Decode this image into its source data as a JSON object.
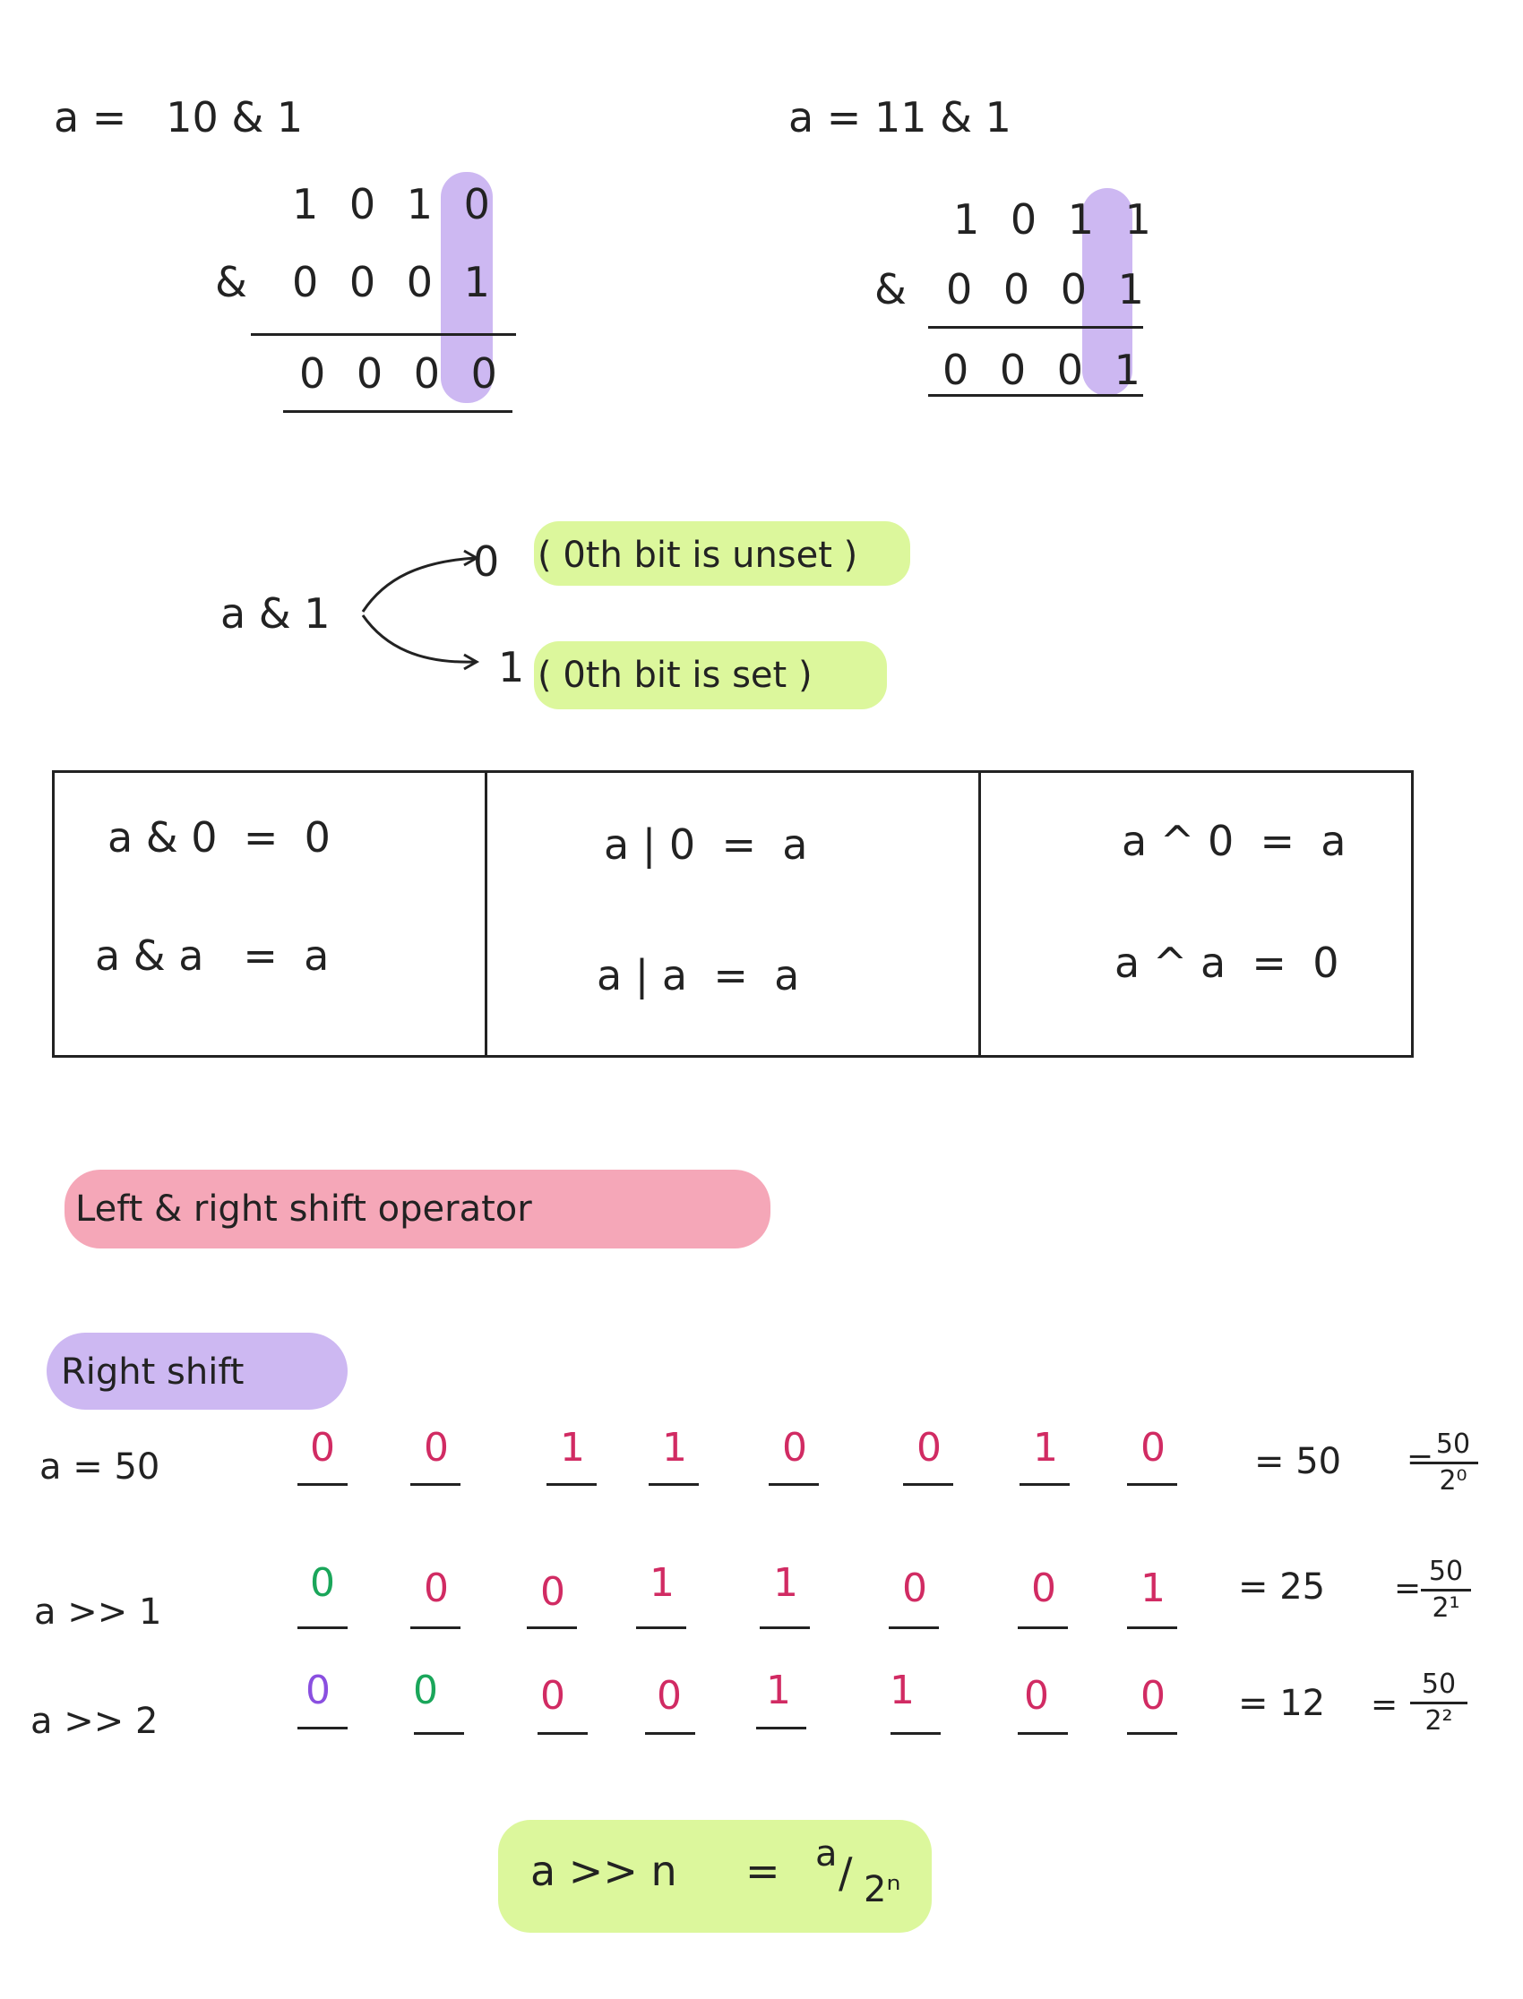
{
  "example1": {
    "title": "a =   10 & 1",
    "row1": "1 0 1 0",
    "op": "&",
    "row2": "0 0 0 1",
    "result": "0 0 0 0"
  },
  "example2": {
    "title": "a = 11 & 1",
    "row1": "1 0 1 1",
    "op": "&",
    "row2": "0 0 0 1",
    "result": "0 0 0 1"
  },
  "branch": {
    "expr": "a & 1",
    "zero_val": "0",
    "zero_note": "( 0th bit is unset )",
    "one_val": "1",
    "one_note": "( 0th bit is set )"
  },
  "identities": {
    "col1": [
      "a & 0  =  0",
      "a & a   =  a"
    ],
    "col2": [
      "a | 0  =  a",
      "a | a  =  a"
    ],
    "col3": [
      "a ^ 0  =  a",
      "a ^ a  =  0"
    ]
  },
  "section_heading": "Left & right shift operator",
  "subsection_heading": "Right shift",
  "shift_rows": [
    {
      "label": "a = 50",
      "bits": [
        "0",
        "0",
        "1",
        "1",
        "0",
        "0",
        "1",
        "0"
      ],
      "result": "= 50",
      "frac_eq": "=",
      "frac_num": "50",
      "frac_den": "2⁰"
    },
    {
      "label": "a >> 1",
      "bits": [
        "0",
        "0",
        "0",
        "1",
        "1",
        "0",
        "0",
        "1"
      ],
      "result": "= 25",
      "frac_eq": "=",
      "frac_num": "50",
      "frac_den": "2¹"
    },
    {
      "label": "a >> 2",
      "bits": [
        "0",
        "0",
        "0",
        "0",
        "1",
        "1",
        "0",
        "0"
      ],
      "result": "= 12",
      "frac_eq": "=",
      "frac_num": "50",
      "frac_den": "2²"
    }
  ],
  "formula": {
    "lhs": "a >> n",
    "eq": "=",
    "num": "a",
    "slash": "/",
    "den": "2ⁿ"
  },
  "colors": {
    "highlight_purple": "#cdb8f2",
    "highlight_green": "#dcf79c",
    "highlight_pink": "#f5a7b8",
    "bit_pink": "#d12b63",
    "bit_green": "#1aa65a",
    "bit_violet": "#8a4fe0"
  }
}
